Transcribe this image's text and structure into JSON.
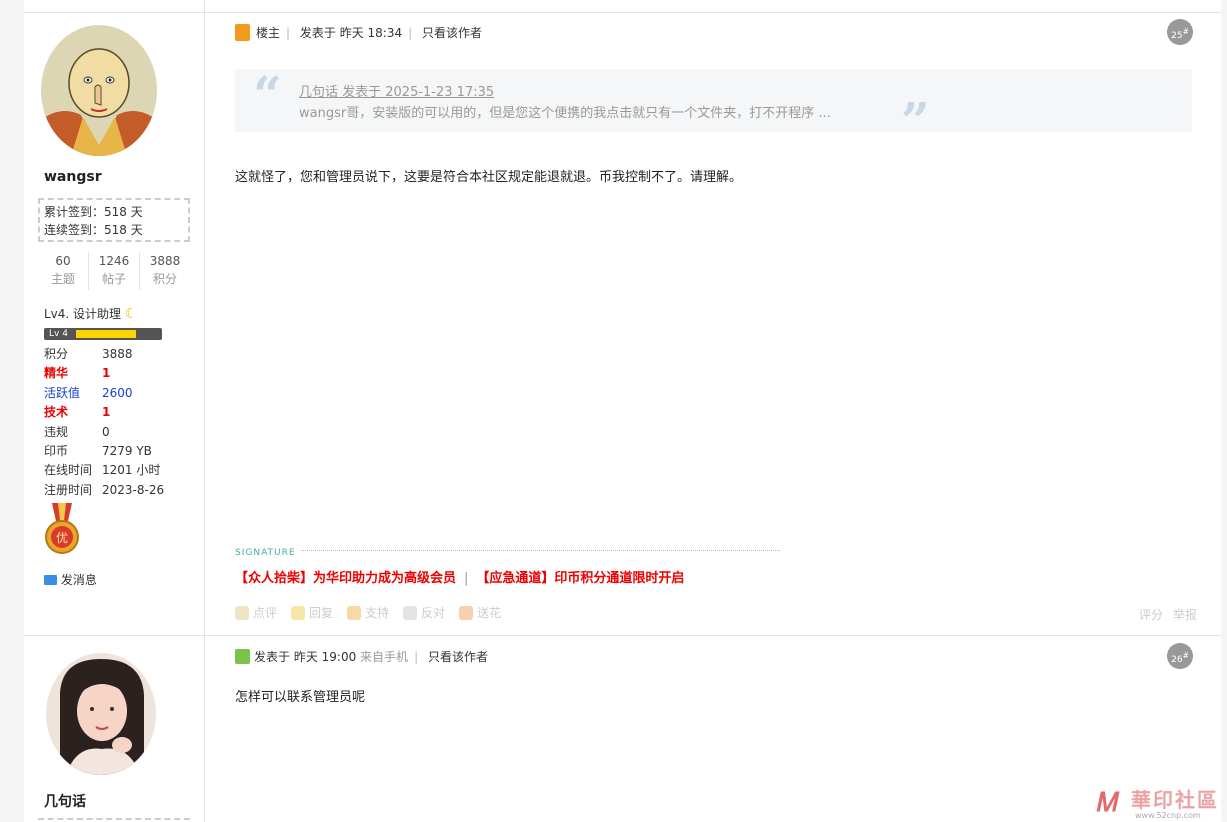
{
  "post1": {
    "username": "wangsr",
    "sign_total": "累计签到：518 天",
    "sign_continuous": "连续签到：518 天",
    "stats": [
      {
        "value": "60",
        "label": "主题"
      },
      {
        "value": "1246",
        "label": "帖子"
      },
      {
        "value": "3888",
        "label": "积分"
      }
    ],
    "level_label": "Lv4. 设计助理",
    "level_bar_text": "Lv 4",
    "level_progress": 0.75,
    "info": [
      {
        "k": "积分",
        "v": "3888"
      },
      {
        "k": "精华",
        "v": "1"
      },
      {
        "k": "活跃值",
        "v": "2600"
      },
      {
        "k": "技术",
        "v": "1"
      },
      {
        "k": "违规",
        "v": "0"
      },
      {
        "k": "印币",
        "v": "7279 YB"
      },
      {
        "k": "在线时间",
        "v": "1201 小时"
      },
      {
        "k": "注册时间",
        "v": "2023-8-26"
      }
    ],
    "medal_char": "优",
    "send_message": "发消息",
    "role": "楼主",
    "posted_at": "发表于 昨天 18:34",
    "only_author": "只看该作者",
    "floor_number": "25",
    "quote": {
      "head": "几句话 发表于 2025-1-23 17:35",
      "body": "wangsr哥，安装版的可以用的，但是您这个便携的我点击就只有一个文件夹，打不开程序 ..."
    },
    "content": "这就怪了，您和管理员说下，这要是符合本社区规定能退就退。币我控制不了。请理解。",
    "signature_label": "SIGNATURE",
    "signature_links": [
      "【众人拾柴】为华印助力成为高级会员",
      "【应急通道】印币积分通道限时开启"
    ],
    "signature_sep": "|",
    "actions": [
      "点评",
      "回复",
      "支持",
      "反对",
      "送花"
    ],
    "actions_right": [
      "评分",
      "举报"
    ]
  },
  "post2": {
    "username": "几句话",
    "posted_at": "发表于 昨天 19:00",
    "from": "来自手机",
    "only_author": "只看该作者",
    "floor_number": "26",
    "content": "怎样可以联系管理员呢"
  },
  "watermark": {
    "title": "華印社區",
    "url": "www.52cnp.com"
  },
  "colors": {
    "red": "#e00000",
    "blue": "#1540d0",
    "quote_bg": "#f5f6f7"
  }
}
